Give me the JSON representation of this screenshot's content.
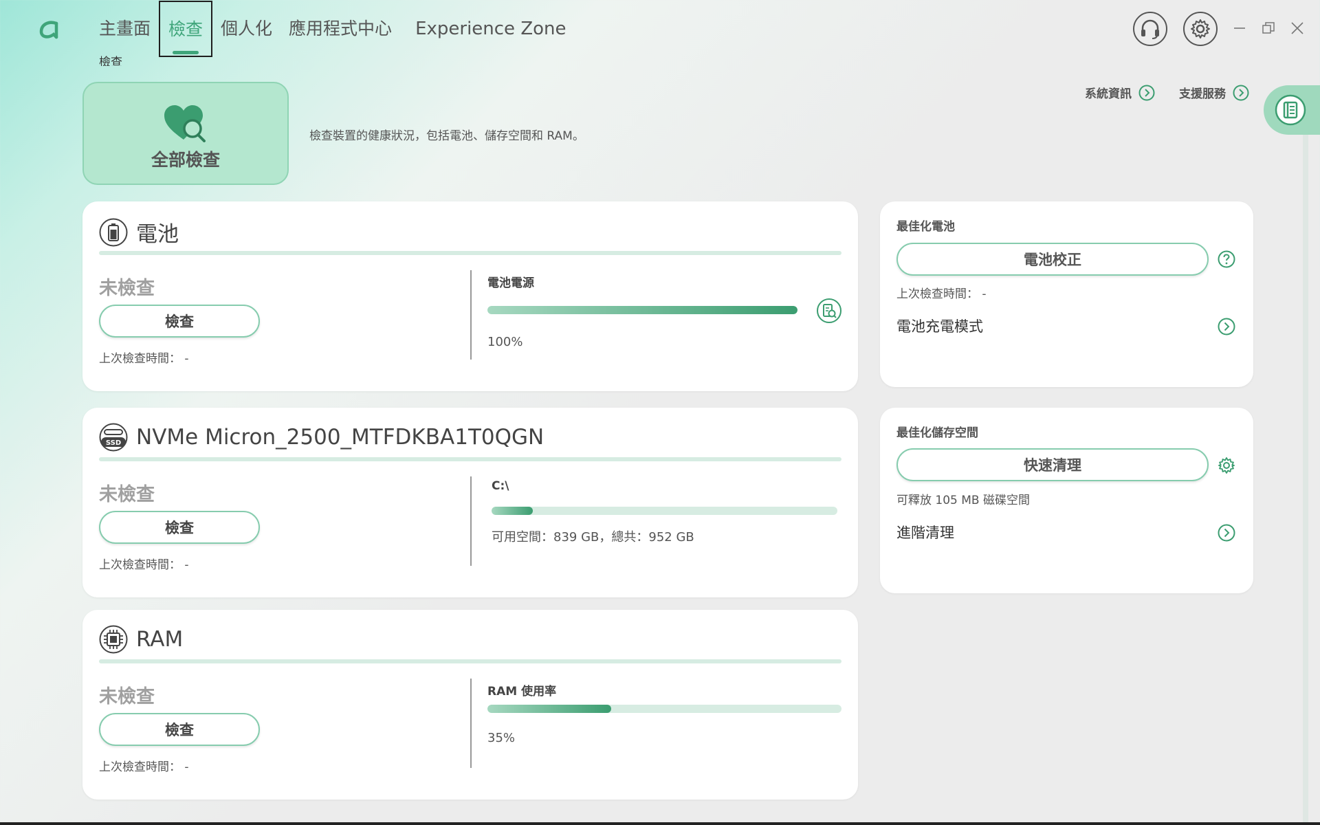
{
  "nav": {
    "tabs": [
      "主畫面",
      "檢查",
      "個人化",
      "應用程式中心",
      "Experience Zone"
    ],
    "active_index": 1,
    "sub_crumb": "檢查"
  },
  "header_links": {
    "system_info": "系統資訊",
    "support": "支援服務"
  },
  "hero": {
    "label": "全部檢查",
    "description": "檢查裝置的健康狀況，包括電池、儲存空間和 RAM。"
  },
  "devices": [
    {
      "name": "電池",
      "icon": "battery-icon",
      "state": "未檢查",
      "button": "檢查",
      "last_check": "上次檢查時間： -",
      "metric_label": "電池電源",
      "metric_percent": 100,
      "metric_value": "100%"
    },
    {
      "name": "NVMe Micron_2500_MTFDKBA1T0QGN",
      "icon": "ssd-icon",
      "state": "未檢查",
      "button": "檢查",
      "last_check": "上次檢查時間： -",
      "metric_label": "C:\\",
      "metric_percent": 12,
      "metric_value": "可用空間：839 GB，總共：952 GB"
    },
    {
      "name": "RAM",
      "icon": "chip-icon",
      "state": "未檢查",
      "button": "檢查",
      "last_check": "上次檢查時間： -",
      "metric_label": "RAM 使用率",
      "metric_percent": 35,
      "metric_value": "35%"
    }
  ],
  "optimize_battery": {
    "title": "最佳化電池",
    "button": "電池校正",
    "sub": "上次檢查時間： -",
    "link": "電池充電模式"
  },
  "optimize_storage": {
    "title": "最佳化儲存空間",
    "button": "快速清理",
    "sub": "可釋放 105 MB 磁碟空間",
    "link": "進階清理"
  },
  "colors": {
    "accent": "#3fa57a",
    "card": "#ffffff",
    "hero": "#b4e7cf"
  }
}
